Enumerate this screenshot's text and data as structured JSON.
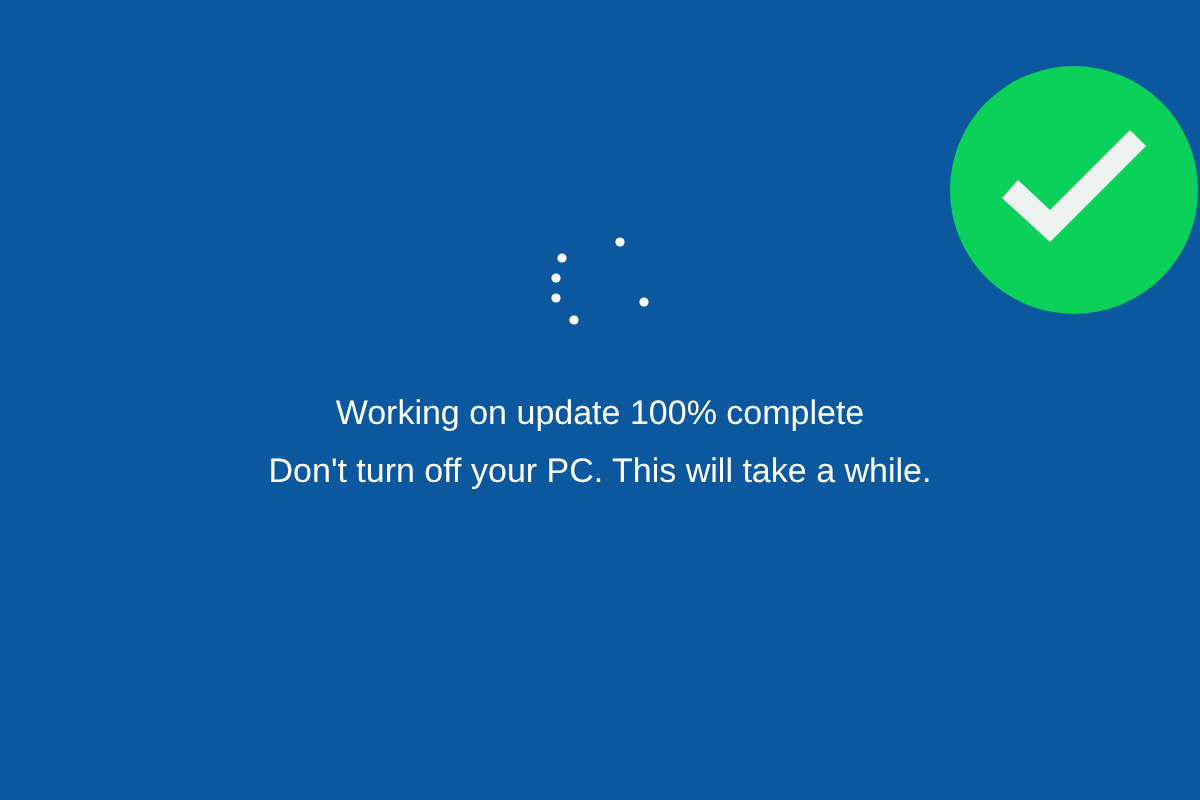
{
  "lines": [
    "Working on update 100% complete",
    "Don't turn off your PC. This will take a while."
  ]
}
